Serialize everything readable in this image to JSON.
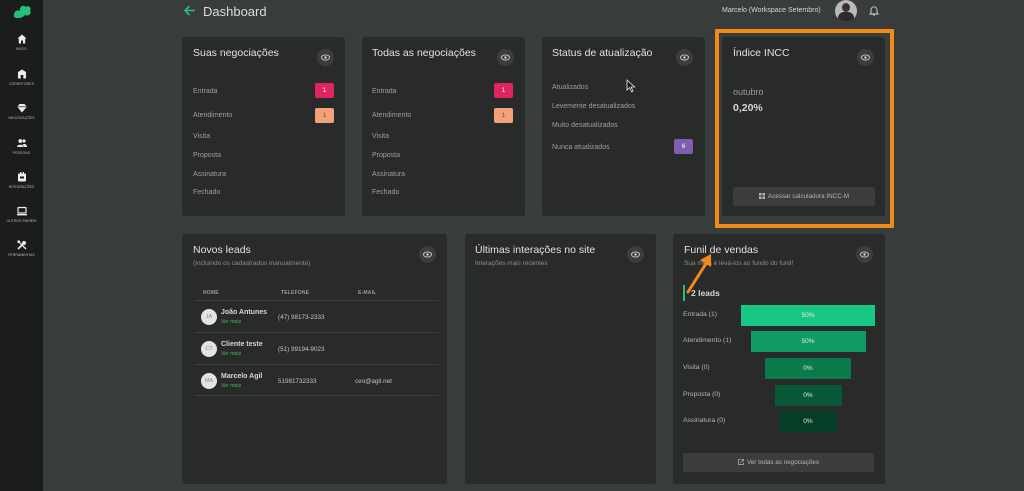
{
  "header": {
    "title": "Dashboard",
    "user": "Marcelo (Workspace Setembro)"
  },
  "sidebar": {
    "items": [
      {
        "label": "INÍCIO",
        "icon": "home-icon"
      },
      {
        "label": "CORRETORES",
        "icon": "building-icon"
      },
      {
        "label": "NEGOCIAÇÕES",
        "icon": "diamond-icon"
      },
      {
        "label": "PESSOAS",
        "icon": "people-icon"
      },
      {
        "label": "INTEGRAÇÕES",
        "icon": "integration-icon"
      },
      {
        "label": "OUTROS PAINÉIS",
        "icon": "monitor-icon"
      },
      {
        "label": "FERRAMENTAS",
        "icon": "tools-icon"
      }
    ]
  },
  "suas": {
    "title": "Suas negociações",
    "rows": [
      {
        "label": "Entrada",
        "badge": "1"
      },
      {
        "label": "Atendimento",
        "badge": "1"
      },
      {
        "label": "Visita"
      },
      {
        "label": "Proposta"
      },
      {
        "label": "Assinatura"
      },
      {
        "label": "Fechado"
      }
    ]
  },
  "todas": {
    "title": "Todas as negociações",
    "rows": [
      {
        "label": "Entrada",
        "badge": "1"
      },
      {
        "label": "Atendimento",
        "badge": "1"
      },
      {
        "label": "Visita"
      },
      {
        "label": "Proposta"
      },
      {
        "label": "Assinatura"
      },
      {
        "label": "Fechado"
      }
    ]
  },
  "status": {
    "title": "Status de atualização",
    "rows": [
      {
        "label": "Atualizados"
      },
      {
        "label": "Levemente desatualizados"
      },
      {
        "label": "Muito desatualizados"
      },
      {
        "label": "Nunca atualizados",
        "badge": "6"
      }
    ]
  },
  "incc": {
    "title": "Índice INCC",
    "month": "outubro",
    "value": "0,20%",
    "button": "Acessar calculadora INCC-M"
  },
  "leads": {
    "title": "Novos leads",
    "subtitle": "(Incluindo os cadastrados manualmente)",
    "columns": [
      "NOME",
      "TELEFONE",
      "E-MAIL"
    ],
    "rows": [
      {
        "initials": "JA",
        "name": "João Antunes",
        "link": "Ver mais",
        "phone": "(47) 98173-2333",
        "email": ""
      },
      {
        "initials": "CT",
        "name": "Cliente teste",
        "link": "Ver mais",
        "phone": "(51) 99194-9023",
        "email": ""
      },
      {
        "initials": "MA",
        "name": "Marcelo Agil",
        "link": "Ver mais",
        "phone": "51981732333",
        "email": "ceo@agil.net"
      }
    ]
  },
  "interacoes": {
    "title": "Últimas interações no site",
    "subtitle": "Interações mais recentes"
  },
  "funil": {
    "title": "Funil de vendas",
    "subtitle": "Sua meta é levá-los ao fundo do funil!",
    "count": "2 leads",
    "stages": [
      {
        "label": "Entrada (1)",
        "value": "50%",
        "fraction": 0.5,
        "color": "#18c784"
      },
      {
        "label": "Atendimento (1)",
        "value": "50%",
        "fraction": 0.5,
        "color": "#109b63"
      },
      {
        "label": "Visita (0)",
        "value": "0%",
        "fraction": 0,
        "color": "#0b7a4a"
      },
      {
        "label": "Proposta (0)",
        "value": "0%",
        "fraction": 0,
        "color": "#075836"
      },
      {
        "label": "Assinatura (0)",
        "value": "0%",
        "fraction": 0,
        "color": "#053e26"
      }
    ],
    "button": "Ver todas as negociações"
  },
  "colors": {
    "accent": "#24c07b",
    "highlight": "#f28a1a",
    "pink": "#e0245e",
    "salmon": "#f2a178",
    "purple": "#7e5ead"
  }
}
